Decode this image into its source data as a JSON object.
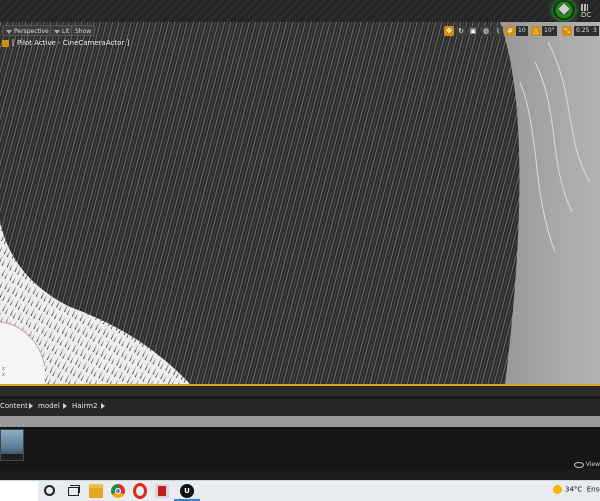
{
  "viewport": {
    "buttons": [
      "Perspective",
      "Lit",
      "Show"
    ],
    "pilot_label": "[ Pilot Active - CineCameraActor ]",
    "grid_snap": "10",
    "rotation_snap": "10°",
    "scale_snap": "0.25",
    "camera_speed": "3"
  },
  "top": {
    "right_label": "DC"
  },
  "content_browser": {
    "breadcrumbs": [
      "Content",
      "model",
      "Hairm2"
    ],
    "view_options_label": "View"
  },
  "taskbar": {
    "apps": [
      "cortana-icon",
      "task-view-icon",
      "file-explorer-icon",
      "chrome-icon",
      "opera-icon",
      "pdf-reader-icon",
      "unreal-engine-icon"
    ],
    "temperature": "34°C",
    "weather": "Ensol",
    "accent": "#3b80d6"
  }
}
